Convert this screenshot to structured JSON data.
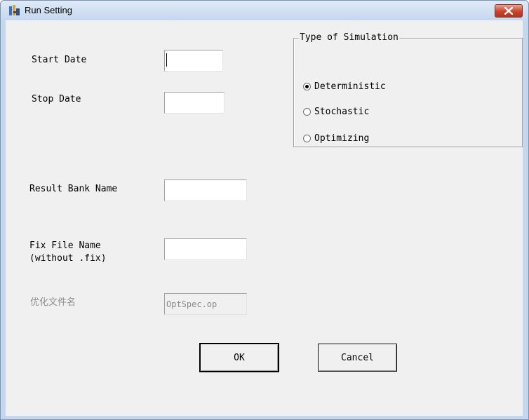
{
  "window": {
    "title": "Run Setting"
  },
  "fields": {
    "start_date": {
      "label": "Start Date",
      "value": ""
    },
    "stop_date": {
      "label": "Stop Date",
      "value": ""
    },
    "result_bank_name": {
      "label": "Result Bank Name",
      "value": ""
    },
    "fix_file_name": {
      "label_line1": "Fix File Name",
      "label_line2": "(without .fix)",
      "value": ""
    },
    "optimization_file": {
      "label": "优化文件名",
      "value": "OptSpec.op"
    }
  },
  "simulation_type": {
    "title": "Type of Simulation",
    "options": [
      {
        "label": "Deterministic",
        "selected": true
      },
      {
        "label": "Stochastic",
        "selected": false
      },
      {
        "label": "Optimizing",
        "selected": false
      }
    ]
  },
  "buttons": {
    "ok": "OK",
    "cancel": "Cancel"
  },
  "colors": {
    "title_bar": "#c5d8ef",
    "close_button": "#c9442c",
    "client_background": "#f0f0f0"
  },
  "icons": [
    "app-icon",
    "close-icon"
  ]
}
